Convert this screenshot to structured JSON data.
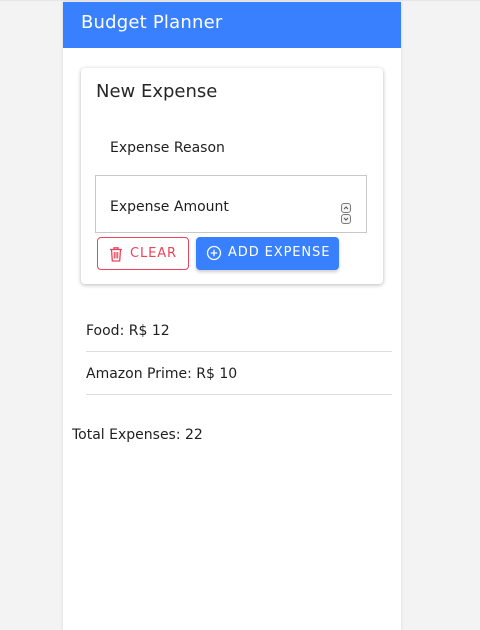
{
  "app": {
    "title": "Budget Planner",
    "accent_color": "#3880ff",
    "danger_color": "#eb445a"
  },
  "form": {
    "title": "New Expense",
    "reason_placeholder": "Expense Reason",
    "amount_placeholder": "Expense Amount",
    "clear_label": "CLEAR",
    "clear_icon": "trash-icon",
    "add_label": "ADD EXPENSE",
    "add_icon": "add-circle-icon"
  },
  "expenses": [
    {
      "text": "Food: R$ 12"
    },
    {
      "text": "Amazon Prime: R$ 10"
    }
  ],
  "total_text": "Total Expenses: 22"
}
